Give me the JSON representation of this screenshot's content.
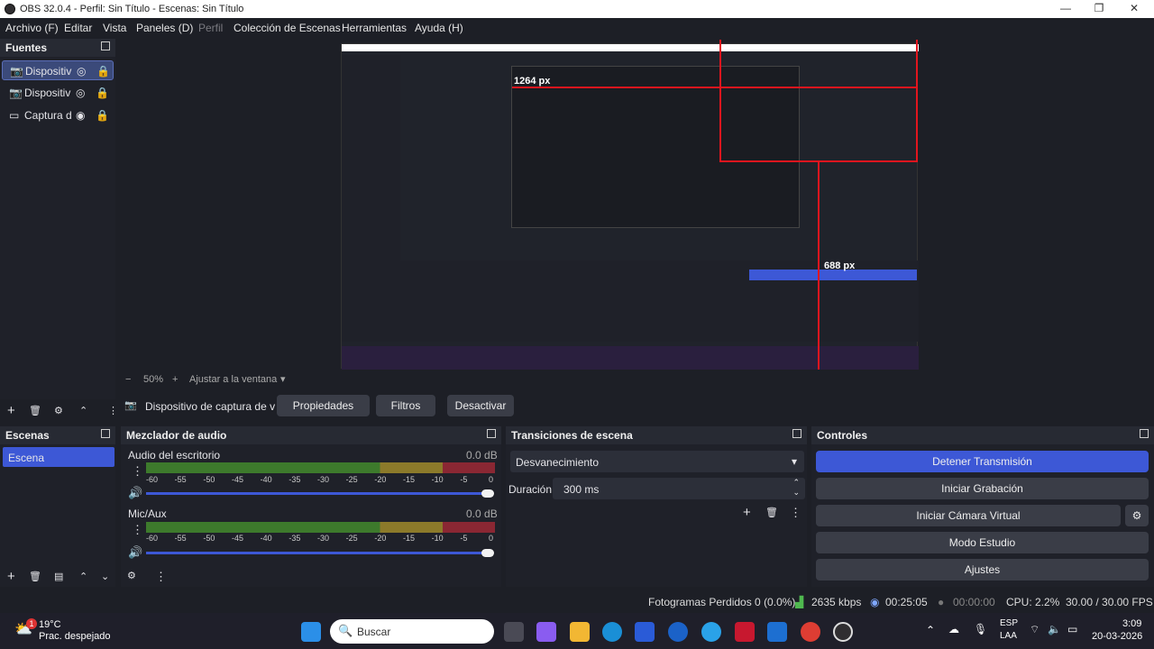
{
  "window": {
    "title": "OBS 32.0.4 - Perfil: Sin Título - Escenas: Sin Título",
    "controls": [
      "—",
      "❐",
      "✕"
    ]
  },
  "menu": [
    "Archivo (F)",
    "Editar",
    "Vista",
    "Paneles (D)",
    "Perfil",
    "Colección de Escenas",
    "Herramientas",
    "Ayuda (H)"
  ],
  "sources": {
    "title": "Fuentes",
    "items": [
      {
        "label": "Dispositiv",
        "icon": "camera-icon"
      },
      {
        "label": "Dispositiv",
        "icon": "camera-icon"
      },
      {
        "label": "Captura d",
        "icon": "monitor-icon"
      }
    ]
  },
  "preview": {
    "width_label": "1264 px",
    "height_label": "688 px"
  },
  "zoom": {
    "minus": "−",
    "value": "50%",
    "plus": "+",
    "fit": "Ajustar a la ventana"
  },
  "source_bar": {
    "name": "Dispositivo de captura de v",
    "properties": "Propiedades",
    "filters": "Filtros",
    "deactivate": "Desactivar"
  },
  "scenes": {
    "title": "Escenas",
    "items": [
      "Escena"
    ]
  },
  "mixer": {
    "title": "Mezclador de audio",
    "channels": [
      {
        "name": "Audio del escritorio",
        "db": "0.0 dB"
      },
      {
        "name": "Mic/Aux",
        "db": "0.0 dB"
      }
    ],
    "ticks": [
      "-60",
      "-55",
      "-50",
      "-45",
      "-40",
      "-35",
      "-30",
      "-25",
      "-20",
      "-15",
      "-10",
      "-5",
      "0"
    ]
  },
  "transitions": {
    "title": "Transiciones de escena",
    "selected": "Desvanecimiento",
    "duration_label": "Duración",
    "duration_value": "300 ms"
  },
  "controls": {
    "title": "Controles",
    "stop_stream": "Detener Transmisión",
    "start_rec": "Iniciar Grabación",
    "virtual_cam": "Iniciar Cámara Virtual",
    "studio": "Modo Estudio",
    "settings": "Ajustes"
  },
  "status": {
    "dropped": "Fotogramas Perdidos 0 (0.0%)",
    "kbps": "2635 kbps",
    "stream_time": "00:25:05",
    "rec_time": "00:00:00",
    "cpu": "CPU: 2.2%",
    "fps": "30.00 / 30.00 FPS"
  },
  "taskbar": {
    "temp": "19°C",
    "weather": "Prac. despejado",
    "badge": "1",
    "search": "Buscar",
    "lang1": "ESP",
    "lang2": "LAA",
    "time": "3:09",
    "date": "20-03-2026"
  },
  "colors": {
    "accent": "#3d58d6",
    "panel": "#1f2129",
    "guide": "#e2151e"
  }
}
